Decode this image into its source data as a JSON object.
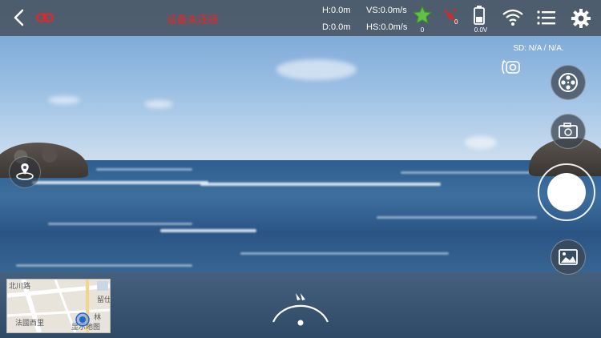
{
  "status": {
    "connection_text": "设备未连接",
    "connection_color": "#e02828"
  },
  "telemetry": {
    "height": "H:0.0m",
    "vertical_speed": "VS:0.0m/s",
    "distance": "D:0.0m",
    "horizontal_speed": "HS:0.0m/s"
  },
  "indicators": {
    "gps_count": "0",
    "satellite_count": "0",
    "voltage": "0.0V"
  },
  "camera": {
    "sd_card": "SD: N/A / N/A."
  },
  "map": {
    "labels": [
      "北川路",
      "法國西里",
      "留仕",
      "显示地图",
      "林"
    ]
  },
  "icons": [
    "back-icon",
    "link-broken-icon",
    "gps-star-icon",
    "satellite-icon",
    "battery-icon",
    "wifi-icon",
    "menu-icon",
    "gear-icon",
    "gimbal-icon",
    "video-reel-icon",
    "camera-switch-icon",
    "gallery-icon",
    "home-point-icon",
    "compass-icon"
  ]
}
